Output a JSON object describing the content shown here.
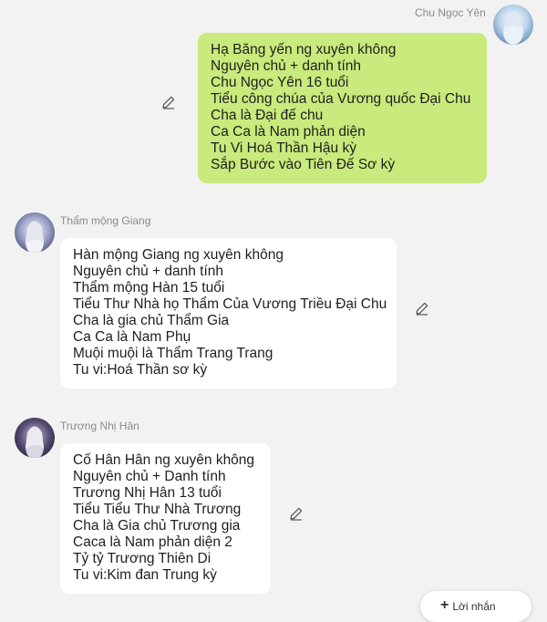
{
  "messages": [
    {
      "sender": "Chu Ngọc Yên",
      "lines": [
        "Hạ Băng yến ng xuyên không",
        "Nguyên chủ + danh tính",
        "Chu Ngọc Yên 16 tuổi",
        "Tiểu công chúa của Vương quốc Đại Chu",
        "Cha là Đại đế chu",
        "Ca Ca là Nam phản diện",
        "Tu Vi Hoá Thần Hậu kỳ",
        "Sắp Bước vào Tiên Đế Sơ kỳ"
      ]
    },
    {
      "sender": "Thẩm mộng Giang",
      "lines": [
        "Hàn mộng Giang ng xuyên không",
        "Nguyên chủ + danh tính",
        "Thẩm mộng Hàn 15 tuổi",
        "Tiểu Thư Nhà họ Thẩm Của Vương Triều Đại Chu",
        "Cha là gia chủ Thẩm Gia",
        "Ca Ca là Nam Phụ",
        "Muội muội là Thẩm Trang Trang",
        "Tu vi:Hoá Thần sơ kỳ"
      ]
    },
    {
      "sender": "Trương Nhị Hân",
      "lines": [
        "Cố Hân Hân ng xuyên không",
        "Nguyên chủ + Danh tính",
        "Trương Nhị Hân 13 tuổi",
        "Tiểu Tiểu Thư Nhà Trương",
        "Cha là Gia chủ Trương gia",
        "Caca là Nam phản diện 2",
        "Tỷ tỷ Trương Thiên Di",
        "Tu vi:Kim đan Trung kỳ"
      ]
    }
  ],
  "reply_button": {
    "label": "Lời nhắn"
  },
  "icons": {
    "edit": "pencil-icon",
    "add": "plus-icon"
  },
  "colors": {
    "background": "#f2f2f2",
    "self_bubble": "#c9ea7c",
    "other_bubble": "#ffffff",
    "sender_name": "#8a8a8a"
  }
}
